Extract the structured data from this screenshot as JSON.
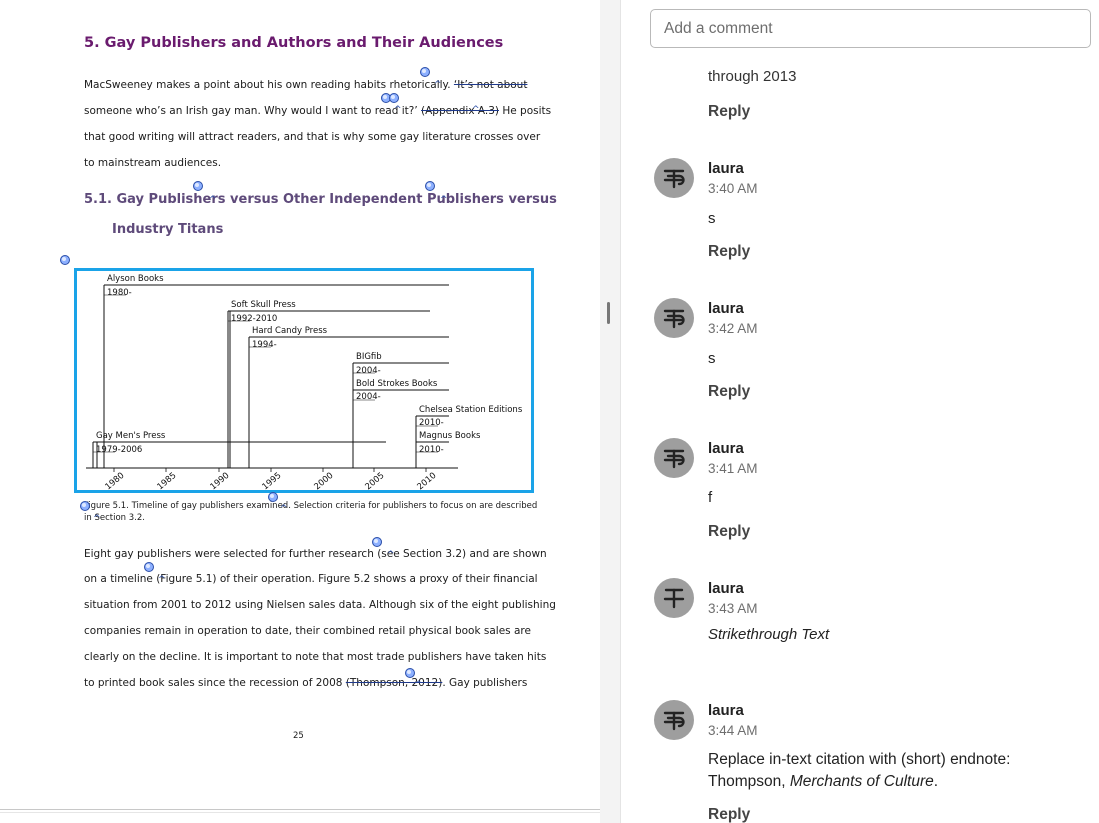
{
  "document": {
    "heading1": "5. Gay Publishers and Authors and Their Audiences",
    "para1": {
      "line1a": "MacSweeney makes a point about his own reading habits rhetorically. ",
      "line1b": "‘It’s not about",
      "line2a": "someone who’s an Irish gay man. Why would I want to read it?’ ",
      "line2b": "(Appendix A.3)",
      "line2c": " He posits",
      "line3": "that good writing will attract readers, and that is why some gay literature crosses over",
      "line4": "to mainstream audiences."
    },
    "heading2_line1": "5.1. Gay Publishers versus Other Independent Publishers versus",
    "heading2_line2": "Industry Titans",
    "figure_caption_line1": "Figure 5.1. Timeline of gay publishers examined. Selection criteria for publishers to focus on are described",
    "figure_caption_line2": "in Section 3.2.",
    "para2": {
      "line1": "Eight gay publishers were selected for further research (see Section 3.2) and are shown",
      "line2": "on a timeline (Figure 5.1) of their operation. Figure 5.2 shows a proxy of their financial",
      "line3": "situation from 2001 to 2012 using Nielsen sales data. Although six of the eight publishing",
      "line4": "companies remain in operation to date, their combined retail physical book sales are",
      "line5": "clearly on the decline. It is important to note that most trade publishers have taken hits",
      "line6a": "to printed book sales since the recession of 2008 ",
      "line6b": "(Thompson, 2012)",
      "line6c": ". Gay publishers"
    },
    "page_number": "25"
  },
  "timeline": {
    "publishers": [
      {
        "name": "Alyson Books",
        "years": "1980-"
      },
      {
        "name": "Soft Skull Press",
        "years": "1992-2010"
      },
      {
        "name": "Hard Candy Press",
        "years": "1994-"
      },
      {
        "name": "BIGfib",
        "years": "2004-"
      },
      {
        "name": "Bold Strokes Books",
        "years": "2004-"
      },
      {
        "name": "Chelsea Station Editions",
        "years": "2010-"
      },
      {
        "name": "Magnus Books",
        "years": "2010-"
      },
      {
        "name": "Gay Men's Press",
        "years": "1979-2006"
      }
    ],
    "axis_ticks": [
      "1980",
      "1985",
      "1990",
      "1995",
      "2000",
      "2005",
      "2010"
    ]
  },
  "comments": {
    "input_placeholder": "Add a comment",
    "partial_text": "through 2013",
    "reply_label": "Reply",
    "items": [
      {
        "author": "laura",
        "time": "3:40 AM",
        "text": "s",
        "icon": "replace-text-icon"
      },
      {
        "author": "laura",
        "time": "3:42 AM",
        "text": "s",
        "icon": "replace-text-icon"
      },
      {
        "author": "laura",
        "time": "3:41 AM",
        "text": "f",
        "icon": "replace-text-icon"
      },
      {
        "author": "laura",
        "time": "3:43 AM",
        "text": "Strikethrough Text",
        "icon": "strikethrough-icon"
      },
      {
        "author": "laura",
        "time": "3:44 AM",
        "text_line1": "Replace in-text citation with (short) endnote:",
        "text_line2_a": "Thompson, ",
        "text_line2_b": "Merchants of Culture",
        "text_line2_c": ".",
        "icon": "replace-text-icon"
      }
    ]
  },
  "colors": {
    "heading": "#6a1b6e",
    "figure_border": "#1aa3e8",
    "marker": "#8db0ff"
  }
}
